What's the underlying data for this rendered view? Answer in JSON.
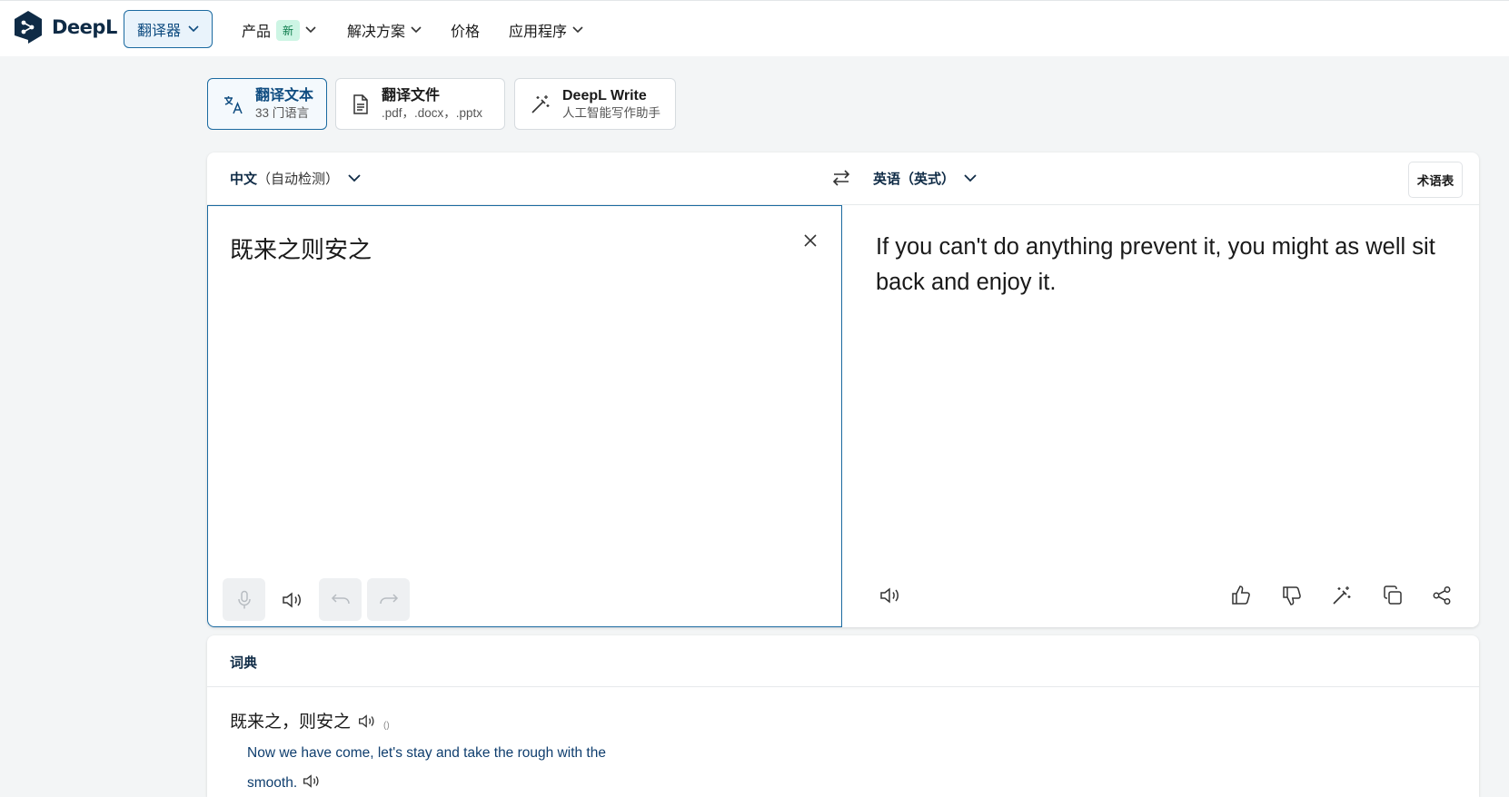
{
  "nav": {
    "brand": "DeepL",
    "translator_label": "翻译器",
    "items": [
      {
        "label": "产品",
        "badge": "新"
      },
      {
        "label": "解决方案"
      },
      {
        "label": "价格"
      },
      {
        "label": "应用程序"
      }
    ]
  },
  "modes": [
    {
      "title": "翻译文本",
      "subtitle": "33 门语言"
    },
    {
      "title": "翻译文件",
      "subtitle": ".pdf，.docx，.pptx"
    },
    {
      "title": "DeepL Write",
      "subtitle": "人工智能写作助手"
    }
  ],
  "translator": {
    "source_lang": "中文",
    "source_lang_note": "（自动检测）",
    "target_lang": "英语（英式）",
    "glossary_label": "术语表",
    "source_text": "既来之则安之",
    "target_text": "If you can't do anything prevent it, you might as well sit back and enjoy it."
  },
  "dictionary": {
    "title": "词典",
    "headword": "既来之，则安之",
    "headword_note": "()",
    "definition": "Now we have come, let's stay and take the rough with the smooth."
  },
  "colors": {
    "accent": "#1b6aa0",
    "brand_dark": "#0f2b46",
    "new_badge_bg": "#cdf5e4",
    "background": "#f3f5f6"
  }
}
